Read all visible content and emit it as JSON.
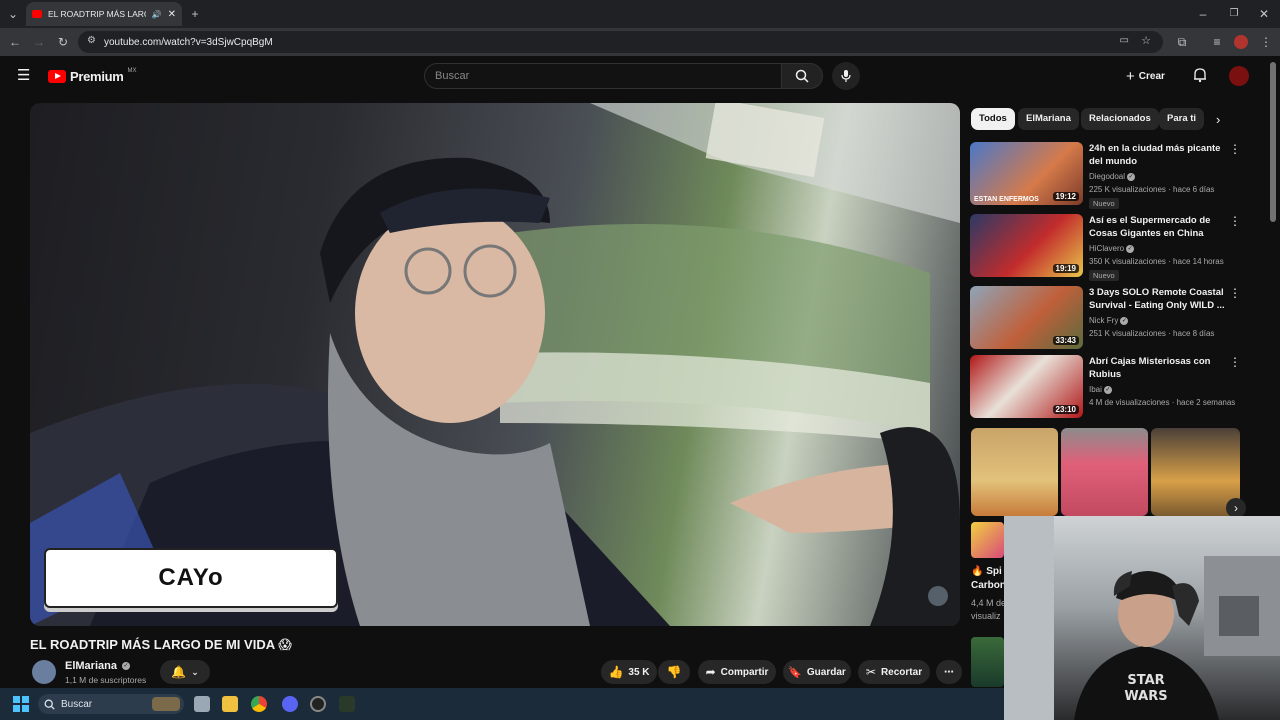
{
  "browser": {
    "tab_title": "EL ROADTRIP MÁS LARGO D",
    "url": "youtube.com/watch?v=3dSjwCpqBgM"
  },
  "header": {
    "logo_word": "Premium",
    "logo_region": "MX",
    "search_placeholder": "Buscar",
    "create_label": "Crear"
  },
  "video": {
    "caption_text": "CAYo",
    "title": "EL ROADTRIP MÁS LARGO DE MI VIDA 😱",
    "channel": "ElMariana",
    "subscribers": "1,1 M de suscriptores",
    "likes": "35 K",
    "share_label": "Compartir",
    "save_label": "Guardar",
    "clip_label": "Recortar"
  },
  "sidebar": {
    "chips": [
      "Todos",
      "ElMariana",
      "Relacionados",
      "Para ti"
    ],
    "recommendations": [
      {
        "title": "24h en la ciudad más picante del mundo",
        "channel": "Diegodoal",
        "meta": "225 K visualizaciones · hace 6 días",
        "badge": "Nuevo",
        "duration": "19:12",
        "thumb_text": "ESTAN ENFERMOS"
      },
      {
        "title": "Así es el Supermercado de Cosas Gigantes en China",
        "channel": "HiClavero",
        "meta": "350 K visualizaciones · hace 14 horas",
        "badge": "Nuevo",
        "duration": "19:19",
        "thumb_text": ""
      },
      {
        "title": "3 Days SOLO Remote Coastal Survival - Eating Only WILD ...",
        "channel": "Nick Fry",
        "meta": "251 K visualizaciones · hace 8 días",
        "badge": "",
        "duration": "33:43",
        "thumb_text": ""
      },
      {
        "title": "Abrí Cajas Misteriosas con Rubius",
        "channel": "Ibai",
        "meta": "4 M de visualizaciones · hace 2 semanas",
        "badge": "",
        "duration": "23:10",
        "thumb_text": ""
      }
    ],
    "partial_item": {
      "title_fragment": "🔥 Spi",
      "title_line2": "Carbon",
      "views": "4,4 M de",
      "views_line2": "visualiz"
    }
  },
  "taskbar": {
    "search_label": "Buscar"
  },
  "colors": {
    "brand_red": "#ff0000",
    "background": "#0f0f0f",
    "pill": "#272727"
  }
}
